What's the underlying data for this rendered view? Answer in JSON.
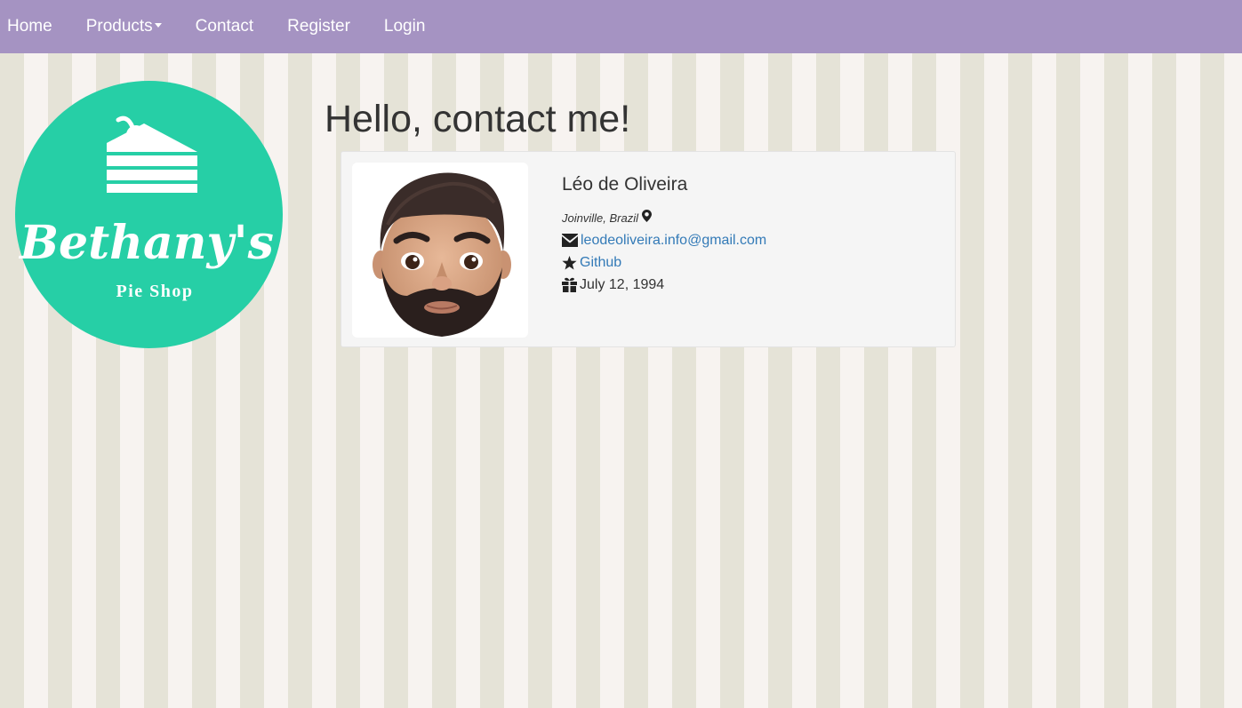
{
  "nav": {
    "items": [
      {
        "label": "Home"
      },
      {
        "label": "Products"
      },
      {
        "label": "Contact"
      },
      {
        "label": "Register"
      },
      {
        "label": "Login"
      }
    ]
  },
  "logo": {
    "line1": "Bethany's",
    "line2": "Pie Shop",
    "color": "#26cfa6"
  },
  "main": {
    "title": "Hello, contact me!"
  },
  "contact": {
    "name": "Léo de Oliveira",
    "location": "Joinville, Brazil",
    "email": "leodeoliveira.info@gmail.com",
    "github_label": "Github",
    "birthday": "July 12, 1994"
  },
  "colors": {
    "navbar": "#a593c2",
    "link": "#337ab7",
    "stripe_a": "#e5e3d7",
    "stripe_b": "#f7f3f0"
  },
  "icons": {
    "location": "map-marker-icon",
    "email": "envelope-icon",
    "github": "star-icon",
    "birthday": "gift-icon",
    "products_dropdown": "caret-down-icon"
  }
}
